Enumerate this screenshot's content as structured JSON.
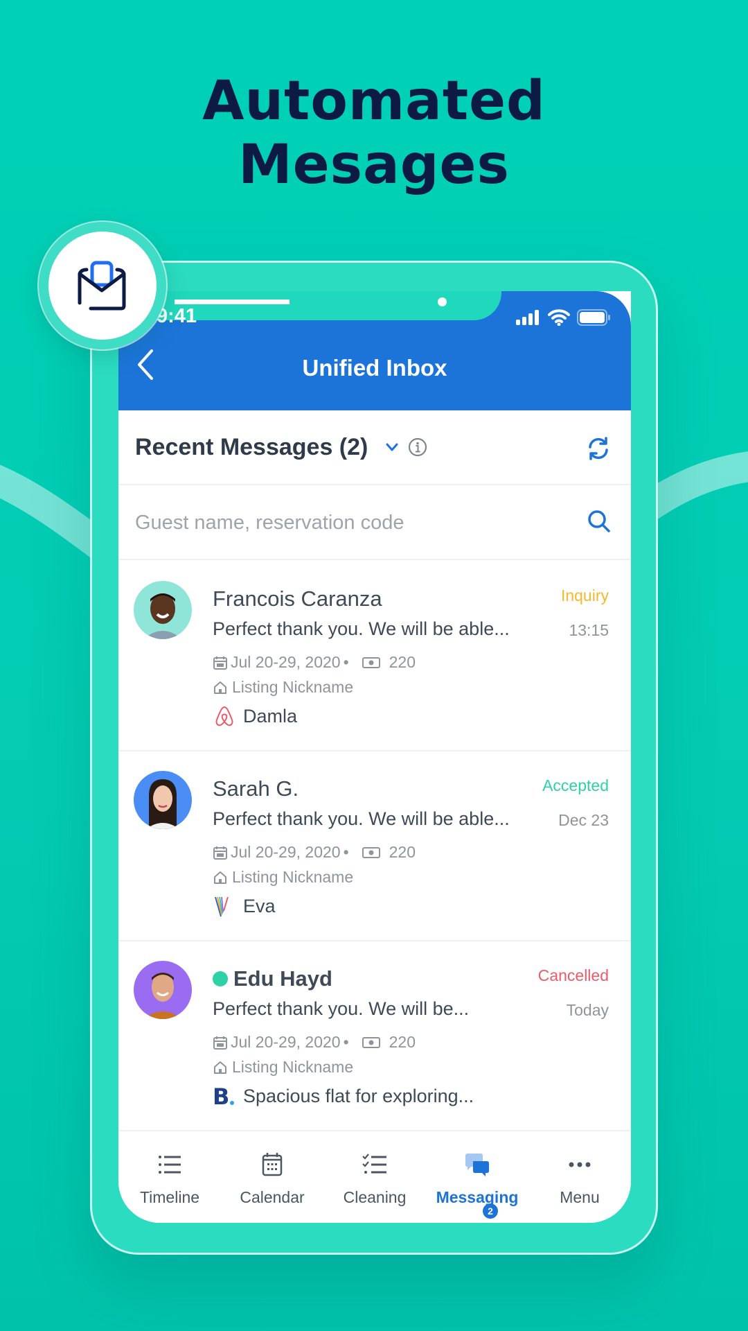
{
  "headline": {
    "line1": "Automated",
    "line2": "Mesages"
  },
  "badge_icon": "envelope-open-icon",
  "status_bar": {
    "time": "9:41",
    "icons": [
      "signal-icon",
      "wifi-icon",
      "battery-icon"
    ]
  },
  "header": {
    "title": "Unified Inbox",
    "back_icon": "chevron-left-icon"
  },
  "section": {
    "title": "Recent Messages (2)",
    "dropdown_icon": "chevron-down-icon",
    "info_icon": "info-icon",
    "refresh_icon": "refresh-icon"
  },
  "search": {
    "placeholder": "Guest name, reservation code",
    "value": "",
    "icon": "search-icon"
  },
  "messages": [
    {
      "name": "Francois Caranza",
      "preview": "Perfect thank you. We will be able...",
      "status": "Inquiry",
      "status_color": "#f5b82e",
      "time": "13:15",
      "dates": "Jul 20-29, 2020",
      "amount": "220",
      "listing": "Listing Nickname",
      "source": "airbnb",
      "source_label": "Damla",
      "avatar_bg": "#8fe6d8",
      "online": false,
      "unread": false
    },
    {
      "name": "Sarah G.",
      "preview": "Perfect thank you. We will be able...",
      "status": "Accepted",
      "status_color": "#2fd1a6",
      "time": "Dec 23",
      "dates": "Jul 20-29, 2020",
      "amount": "220",
      "listing": "Listing Nickname",
      "source": "vrbo",
      "source_label": "Eva",
      "avatar_bg": "#4a8ef5",
      "online": false,
      "unread": false
    },
    {
      "name": "Edu Hayd",
      "preview": "Perfect thank you. We will be...",
      "status": "Cancelled",
      "status_color": "#ec5b6a",
      "time": "Today",
      "dates": "Jul 20-29, 2020",
      "amount": "220",
      "listing": "Listing Nickname",
      "source": "booking",
      "source_label": "Spacious flat for exploring...",
      "avatar_bg": "#9a6cf2",
      "online": true,
      "unread": true
    }
  ],
  "tabs": [
    {
      "label": "Timeline",
      "icon": "list-icon",
      "active": false
    },
    {
      "label": "Calendar",
      "icon": "calendar-icon",
      "active": false
    },
    {
      "label": "Cleaning",
      "icon": "checklist-icon",
      "active": false
    },
    {
      "label": "Messaging",
      "icon": "chat-bubbles-icon",
      "active": true,
      "badge": "2"
    },
    {
      "label": "Menu",
      "icon": "more-dots-icon",
      "active": false
    }
  ],
  "colors": {
    "background": "#00d1b6",
    "primary_blue": "#1c74d9",
    "headline": "#0c1a44",
    "text_dark": "#3e4a57",
    "text_muted": "#8d949c"
  }
}
